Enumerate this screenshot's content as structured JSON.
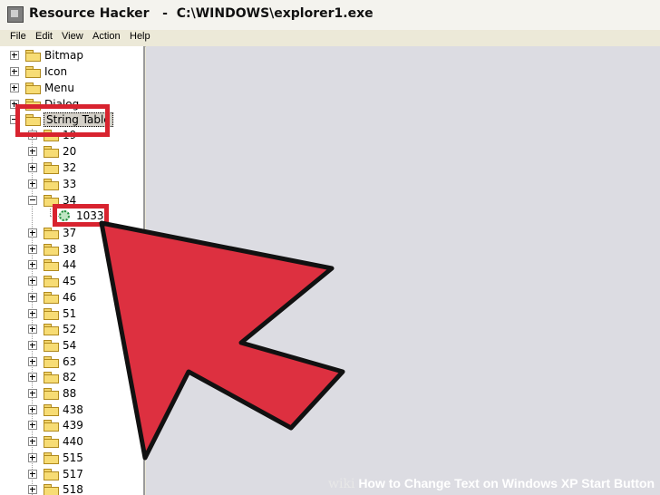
{
  "window": {
    "title": "Resource Hacker   -  C:\\WINDOWS\\explorer1.exe"
  },
  "menu": [
    "File",
    "Edit",
    "View",
    "Action",
    "Help"
  ],
  "tree": {
    "top_items": [
      "Bitmap",
      "Icon",
      "Menu",
      "Dialog"
    ],
    "string_table": "String Table",
    "string_children_before": [
      "19",
      "20",
      "32",
      "33",
      "34"
    ],
    "selected_leaf": "1033",
    "string_children_after": [
      "37",
      "38",
      "44",
      "45",
      "46",
      "51",
      "52",
      "54",
      "63",
      "82",
      "88",
      "438",
      "439",
      "440",
      "515",
      "517",
      "518"
    ]
  },
  "watermark": {
    "brand": "wiki",
    "text": "How to Change Text on Windows XP Start Button"
  },
  "colors": {
    "highlight": "#d8232f",
    "arrow_fill": "#dd3040",
    "content_bg": "#dcdce2"
  }
}
